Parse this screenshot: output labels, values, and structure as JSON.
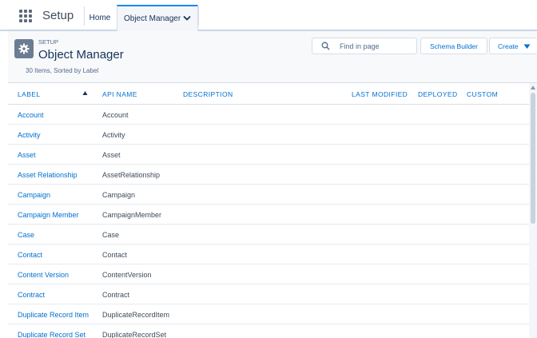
{
  "topnav": {
    "app_name": "Setup",
    "home_tab": "Home",
    "active_tab": "Object Manager",
    "app_launcher_icon": "grid-9-dots-icon",
    "tab_menu_icon": "chevron-down-icon"
  },
  "header": {
    "setup_label": "SETUP",
    "title": "Object Manager",
    "subtitle": "30 Items, Sorted by Label",
    "icon": "gear-icon",
    "search_placeholder": "Find in page",
    "search_icon": "search-icon",
    "schema_builder_label": "Schema Builder",
    "create_label": "Create",
    "create_icon": "caret-down-icon"
  },
  "table": {
    "columns": [
      "LABEL",
      "API NAME",
      "DESCRIPTION",
      "LAST MODIFIED",
      "DEPLOYED",
      "CUSTOM"
    ],
    "sort_icon": "sort-ascending-icon",
    "rows": [
      {
        "label": "Account",
        "api_name": "Account"
      },
      {
        "label": "Activity",
        "api_name": "Activity"
      },
      {
        "label": "Asset",
        "api_name": "Asset"
      },
      {
        "label": "Asset Relationship",
        "api_name": "AssetRelationship"
      },
      {
        "label": "Campaign",
        "api_name": "Campaign"
      },
      {
        "label": "Campaign Member",
        "api_name": "CampaignMember"
      },
      {
        "label": "Case",
        "api_name": "Case"
      },
      {
        "label": "Contact",
        "api_name": "Contact"
      },
      {
        "label": "Content Version",
        "api_name": "ContentVersion"
      },
      {
        "label": "Contract",
        "api_name": "Contract"
      },
      {
        "label": "Duplicate Record Item",
        "api_name": "DuplicateRecordItem"
      },
      {
        "label": "Duplicate Record Set",
        "api_name": "DuplicateRecordSet"
      }
    ]
  },
  "colors": {
    "link": "#0070d2",
    "text": "#16325c",
    "border": "#d8dde6",
    "header_bg": "#f7f9fb",
    "active_tab_accent": "#1589ee"
  }
}
